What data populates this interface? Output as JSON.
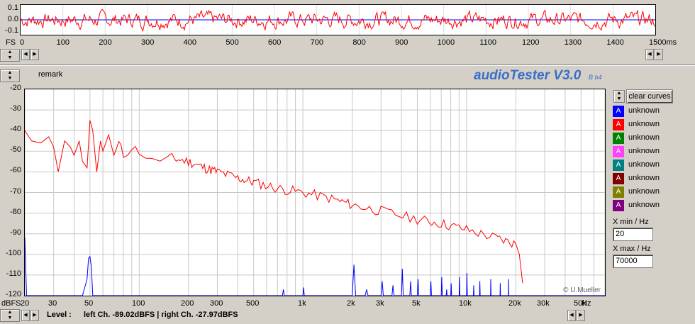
{
  "top_plot": {
    "y_ticks": [
      "0.1",
      "0.0",
      "-0.1"
    ],
    "x_unit_left": "FS",
    "x_ticks": [
      "0",
      "100",
      "200",
      "300",
      "400",
      "500",
      "600",
      "700",
      "800",
      "900",
      "1000",
      "1100",
      "1200",
      "1300",
      "1400",
      "1500ms"
    ]
  },
  "header": {
    "remark_label": "remark",
    "app_title": "audioTester V3.0",
    "app_version": "B b4"
  },
  "main_plot": {
    "y_ticks": [
      "-20",
      "-30",
      "-40",
      "-50",
      "-60",
      "-70",
      "-80",
      "-90",
      "-100",
      "-110",
      "-120"
    ],
    "y_unit": "dBFS",
    "x_ticks": [
      "20",
      "30",
      "50",
      "100",
      "200",
      "300",
      "500",
      "1k",
      "2k",
      "3k",
      "5k",
      "10k",
      "20k",
      "30k",
      "50k"
    ],
    "x_unit": "Hz",
    "copyright": "© U.Mueller"
  },
  "level_bar": {
    "label": "Level :",
    "text": "left Ch. -89.02dBFS | right Ch. -27.97dBFS"
  },
  "legend": {
    "clear_label": "clear curves",
    "items": [
      {
        "glyph": "A",
        "label": "unknown",
        "color": "#0000ff"
      },
      {
        "glyph": "A",
        "label": "unknown",
        "color": "#ff0000"
      },
      {
        "glyph": "A",
        "label": "unknown",
        "color": "#008000"
      },
      {
        "glyph": "A",
        "label": "unknown",
        "color": "#ff40ff"
      },
      {
        "glyph": "A",
        "label": "unknown",
        "color": "#008080"
      },
      {
        "glyph": "A",
        "label": "unknown",
        "color": "#800000"
      },
      {
        "glyph": "A",
        "label": "unknown",
        "color": "#808000"
      },
      {
        "glyph": "A",
        "label": "unknown",
        "color": "#800080"
      }
    ],
    "xmin_label": "X min / Hz",
    "xmin_value": "20",
    "xmax_label": "X max / Hz",
    "xmax_value": "70000"
  },
  "chart_data": [
    {
      "type": "line",
      "series": [
        {
          "color": "#ff0000"
        },
        {
          "color": "#0000ff"
        }
      ],
      "xlim": [
        0,
        1500
      ],
      "ylim": [
        -0.15,
        0.15
      ],
      "grid": true
    },
    {
      "type": "line",
      "x_scale": "log",
      "xlim": [
        20,
        70000
      ],
      "ylim": [
        -120,
        -20
      ],
      "grid": true,
      "series": [
        {
          "color": "#ff0000",
          "x": [
            20,
            22,
            25,
            28,
            30,
            32,
            35,
            38,
            40,
            43,
            45,
            48,
            50,
            52,
            55,
            58,
            60,
            65,
            70,
            75,
            80,
            90,
            100,
            120,
            150,
            200,
            250,
            300,
            400,
            500,
            700,
            1000,
            1500,
            2000,
            3000,
            5000,
            7000,
            10000,
            15000,
            20000,
            21000,
            22000
          ],
          "y": [
            -40,
            -45,
            -46,
            -43,
            -48,
            -60,
            -45,
            -48,
            -52,
            -45,
            -55,
            -58,
            -35,
            -40,
            -60,
            -45,
            -50,
            -42,
            -52,
            -46,
            -52,
            -48,
            -50,
            -55,
            -53,
            -55,
            -58,
            -60,
            -63,
            -65,
            -68,
            -70,
            -73,
            -76,
            -79,
            -83,
            -85,
            -88,
            -92,
            -95,
            -100,
            -114
          ]
        },
        {
          "color": "#0000ff",
          "x": [
            20,
            20.5,
            21,
            45,
            48,
            49,
            50,
            51,
            52,
            55,
            750,
            760,
            770,
            1000,
            1010,
            1020,
            2000,
            2050,
            2100,
            2400,
            2450,
            2500,
            3000,
            3050,
            3100,
            3500,
            3550,
            3600,
            4000,
            4050,
            4100,
            4500,
            4550,
            4600,
            5000,
            5050,
            5100,
            6000,
            6050,
            6100,
            7000,
            7050,
            7100,
            7500,
            7550,
            7600,
            8000,
            8050,
            8100,
            9000,
            9050,
            9100,
            10000,
            10050,
            10100,
            11000,
            11050,
            11100,
            12000,
            12050,
            12100,
            14000,
            14050,
            14100,
            16000,
            16050,
            16100,
            18000,
            18050,
            18100,
            70000
          ],
          "y": [
            -92,
            -120,
            -120,
            -120,
            -112,
            -102,
            -101,
            -106,
            -120,
            -120,
            -120,
            -117,
            -120,
            -120,
            -116,
            -120,
            -120,
            -105,
            -120,
            -120,
            -117,
            -120,
            -120,
            -113,
            -120,
            -120,
            -115,
            -120,
            -120,
            -107,
            -120,
            -120,
            -113,
            -120,
            -120,
            -112,
            -120,
            -120,
            -113,
            -120,
            -120,
            -111,
            -120,
            -120,
            -117,
            -120,
            -120,
            -114,
            -120,
            -120,
            -111,
            -120,
            -120,
            -109,
            -120,
            -120,
            -115,
            -120,
            -120,
            -113,
            -120,
            -120,
            -112,
            -120,
            -120,
            -114,
            -120,
            -120,
            -112,
            -120,
            -120
          ]
        }
      ]
    }
  ]
}
